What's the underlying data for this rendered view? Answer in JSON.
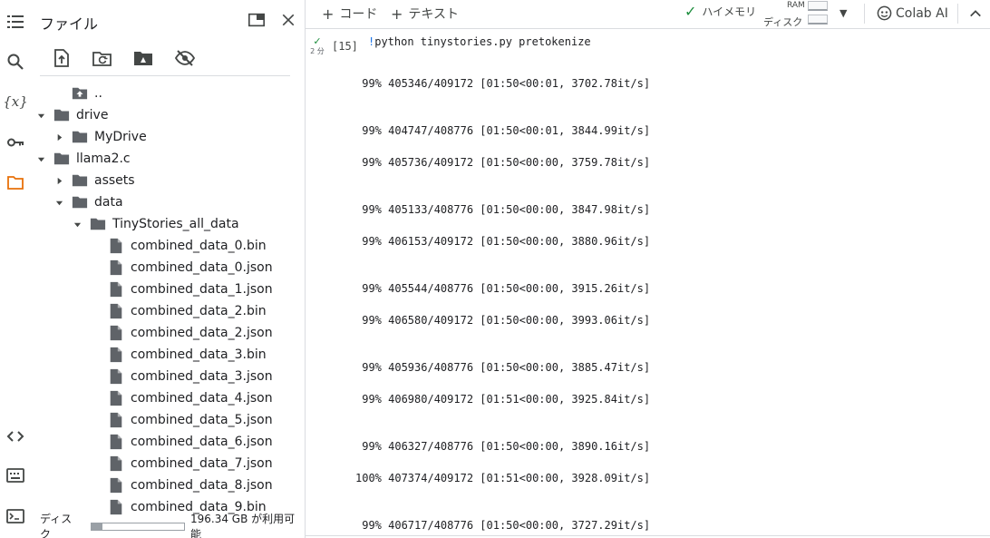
{
  "sidebar": {
    "title": "ファイル",
    "rail_icons": [
      "table-of-contents-icon",
      "search-icon",
      "variables-icon",
      "secrets-key-icon",
      "files-icon",
      "code-snippets-icon",
      "command-palette-icon",
      "terminal-icon"
    ],
    "tree": [
      {
        "label": "..",
        "kind": "up",
        "depth": 1,
        "caret": "none"
      },
      {
        "label": "drive",
        "kind": "folder",
        "depth": 0,
        "caret": "open"
      },
      {
        "label": "MyDrive",
        "kind": "folder",
        "depth": 1,
        "caret": "closed"
      },
      {
        "label": "llama2.c",
        "kind": "folder",
        "depth": 0,
        "caret": "open"
      },
      {
        "label": "assets",
        "kind": "folder",
        "depth": 1,
        "caret": "closed"
      },
      {
        "label": "data",
        "kind": "folder",
        "depth": 1,
        "caret": "open"
      },
      {
        "label": "TinyStories_all_data",
        "kind": "folder",
        "depth": 2,
        "caret": "open"
      },
      {
        "label": "combined_data_0.bin",
        "kind": "file",
        "depth": 3,
        "caret": "none"
      },
      {
        "label": "combined_data_0.json",
        "kind": "file",
        "depth": 3,
        "caret": "none"
      },
      {
        "label": "combined_data_1.json",
        "kind": "file",
        "depth": 3,
        "caret": "none"
      },
      {
        "label": "combined_data_2.bin",
        "kind": "file",
        "depth": 3,
        "caret": "none"
      },
      {
        "label": "combined_data_2.json",
        "kind": "file",
        "depth": 3,
        "caret": "none"
      },
      {
        "label": "combined_data_3.bin",
        "kind": "file",
        "depth": 3,
        "caret": "none"
      },
      {
        "label": "combined_data_3.json",
        "kind": "file",
        "depth": 3,
        "caret": "none"
      },
      {
        "label": "combined_data_4.json",
        "kind": "file",
        "depth": 3,
        "caret": "none"
      },
      {
        "label": "combined_data_5.json",
        "kind": "file",
        "depth": 3,
        "caret": "none"
      },
      {
        "label": "combined_data_6.json",
        "kind": "file",
        "depth": 3,
        "caret": "none"
      },
      {
        "label": "combined_data_7.json",
        "kind": "file",
        "depth": 3,
        "caret": "none"
      },
      {
        "label": "combined_data_8.json",
        "kind": "file",
        "depth": 3,
        "caret": "none"
      },
      {
        "label": "combined_data_9.bin",
        "kind": "file",
        "depth": 3,
        "caret": "none"
      }
    ],
    "disk": {
      "label": "ディスク",
      "used_fraction": 0.12,
      "free_text": "196.34 GB が利用可能"
    }
  },
  "toolbar": {
    "add_code": "コード",
    "add_text": "テキスト",
    "connection": "ハイメモリ",
    "ram_label": "RAM",
    "disk_label": "ディスク",
    "colab_ai": "Colab AI"
  },
  "cell": {
    "exec_time": "2 分",
    "exec_count": "[15]",
    "code_bang": "!",
    "code_text": "python tinystories.py pretokenize",
    "output_lines": [
      " 99% 405346/409172 [01:50<00:01, 3702.78it/s]",
      " 99% 404747/408776 [01:50<00:01, 3844.99it/s]",
      " 99% 405736/409172 [01:50<00:00, 3759.78it/s]",
      " 99% 405133/408776 [01:50<00:00, 3847.98it/s]",
      " 99% 406153/409172 [01:50<00:00, 3880.96it/s]",
      " 99% 405544/408776 [01:50<00:00, 3915.26it/s]",
      " 99% 406580/409172 [01:50<00:00, 3993.06it/s]",
      " 99% 405936/408776 [01:50<00:00, 3885.47it/s]",
      " 99% 406980/409172 [01:51<00:00, 3925.84it/s]",
      " 99% 406327/408776 [01:50<00:00, 3890.16it/s]",
      "100% 407374/409172 [01:51<00:00, 3928.09it/s]",
      " 99% 406717/408776 [01:50<00:00, 3727.29it/s]"
    ]
  },
  "colors": {
    "accent_green": "#1e8e3e",
    "folder_icon": "#5f6368",
    "link_blue": "#1a73e8"
  }
}
